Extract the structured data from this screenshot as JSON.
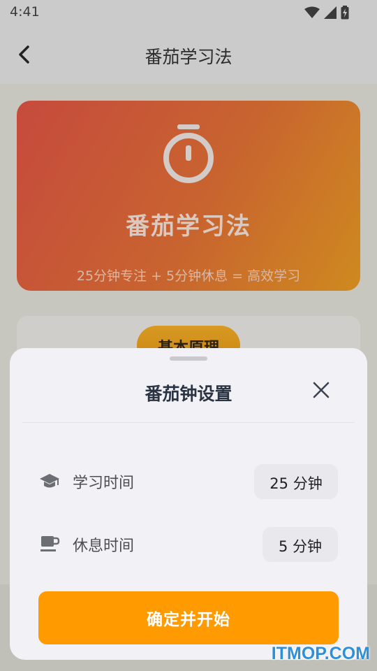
{
  "status_bar": {
    "time": "4:41",
    "icons": [
      "wifi-icon",
      "cellular-signal-icon",
      "battery-charging-icon"
    ]
  },
  "app_bar": {
    "title": "番茄学习法",
    "back_icon": "chevron-left-icon"
  },
  "hero": {
    "icon": "stopwatch-icon",
    "title": "番茄学习法",
    "subtitle": "25分钟专注 + 5分钟休息 = 高效学习",
    "gradient": [
      "#c64a3d",
      "#cf8a1f"
    ]
  },
  "principle_card": {
    "label": "基本原理"
  },
  "sheet": {
    "title": "番茄钟设置",
    "close_icon": "close-icon",
    "rows": [
      {
        "icon": "graduation-cap-icon",
        "label": "学习时间",
        "value": "25 分钟"
      },
      {
        "icon": "coffee-cup-icon",
        "label": "休息时间",
        "value": "5 分钟"
      }
    ],
    "start_button": "确定并开始",
    "accent": "#ff9a00"
  },
  "watermark": "ITMOP.COM"
}
